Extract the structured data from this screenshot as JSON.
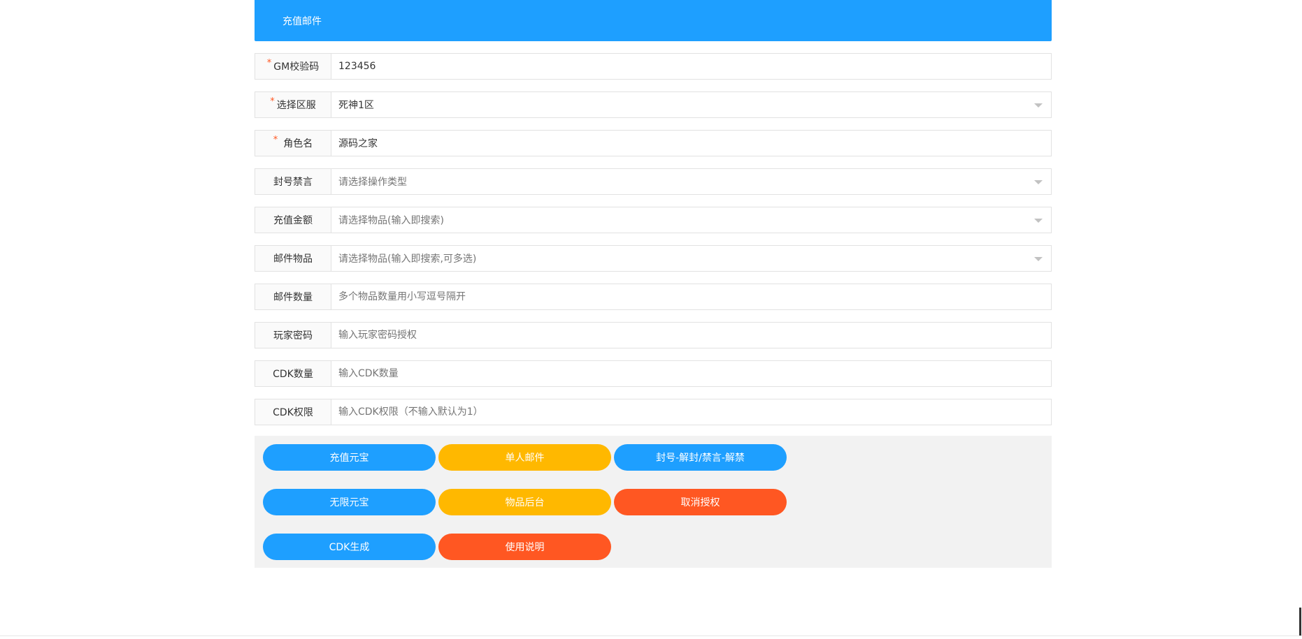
{
  "header": {
    "title": "充值邮件"
  },
  "form": {
    "gm_code": {
      "label": "GM校验码",
      "value": "123456",
      "required": true
    },
    "server": {
      "label": "选择区服",
      "value": "死神1区",
      "required": true
    },
    "role_name": {
      "label": "角色名",
      "value": "源码之家",
      "required": true
    },
    "ban_type": {
      "label": "封号禁言",
      "placeholder": "请选择操作类型"
    },
    "recharge_amount": {
      "label": "充值金额",
      "placeholder": "请选择物品(输入即搜索)"
    },
    "mail_items": {
      "label": "邮件物品",
      "placeholder": "请选择物品(输入即搜索,可多选)"
    },
    "mail_count": {
      "label": "邮件数量",
      "placeholder": "多个物品数量用小写逗号隔开"
    },
    "player_password": {
      "label": "玩家密码",
      "placeholder": "输入玩家密码授权"
    },
    "cdk_count": {
      "label": "CDK数量",
      "placeholder": "输入CDK数量"
    },
    "cdk_permission": {
      "label": "CDK权限",
      "placeholder": "输入CDK权限（不输入默认为1）"
    },
    "required_mark": "*"
  },
  "buttons": {
    "recharge_yuanbao": "充值元宝",
    "single_mail": "单人邮件",
    "ban_unban": "封号-解封/禁言-解禁",
    "unlimited_yuanbao": "无限元宝",
    "item_backend": "物品后台",
    "cancel_auth": "取消授权",
    "cdk_generate": "CDK生成",
    "usage_guide": "使用说明"
  },
  "colors": {
    "primary": "#1e9fff",
    "warm": "#ffb800",
    "danger": "#ff5722"
  }
}
